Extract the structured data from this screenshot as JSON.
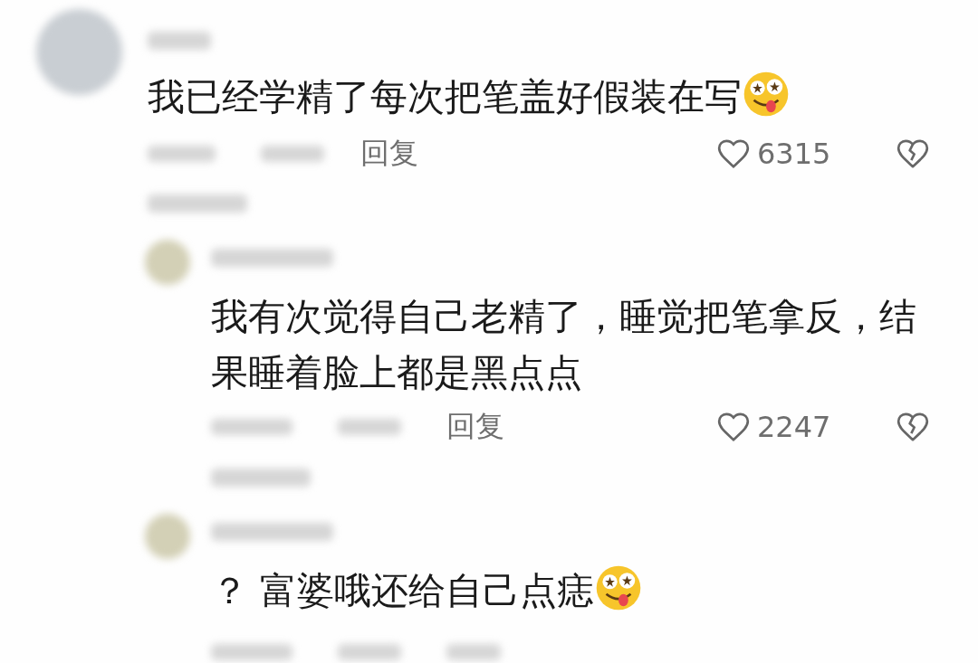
{
  "comments": [
    {
      "kind": "comment",
      "text": "我已经学精了每次把笔盖好假装在写",
      "emoji": true,
      "reply_label": "回复",
      "likes": "6315",
      "expand": true
    },
    {
      "kind": "reply",
      "text": "我有次觉得自己老精了，睡觉把笔拿反，结果睡着脸上都是黑点点",
      "emoji": false,
      "reply_label": "回复",
      "likes": "2247",
      "expand": true
    },
    {
      "kind": "reply",
      "text": "？ 富婆哦还给自己点痣",
      "emoji": true,
      "expand": false
    }
  ]
}
